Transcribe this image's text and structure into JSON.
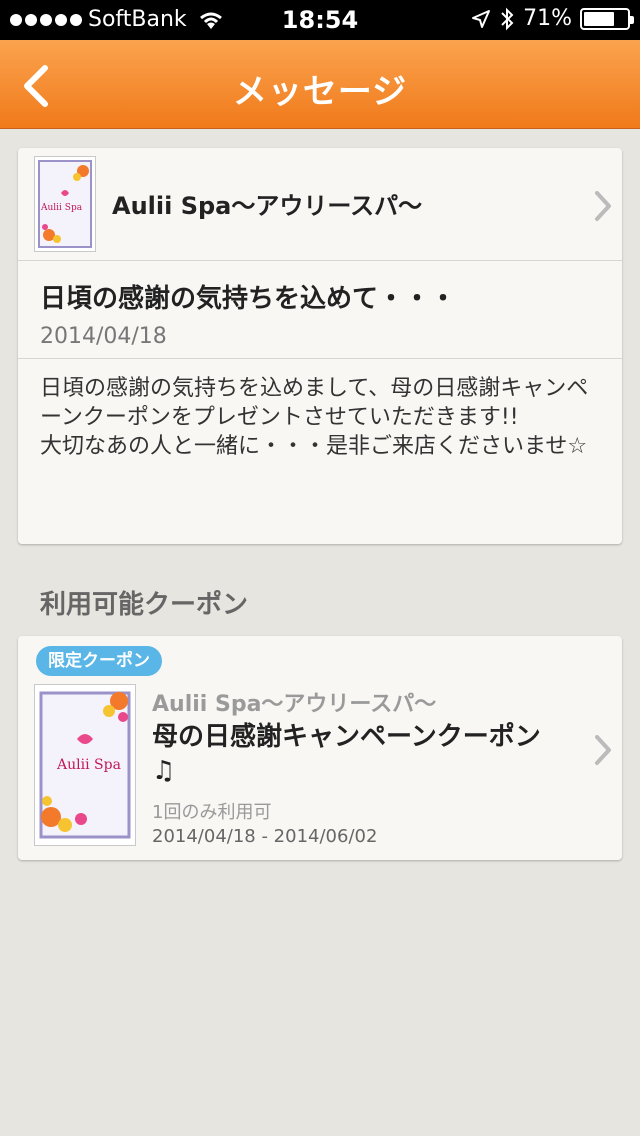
{
  "status_bar": {
    "carrier": "SoftBank",
    "time": "18:54",
    "battery_percent": "71%",
    "battery_level": 0.71
  },
  "navbar": {
    "title": "メッセージ",
    "back_icon": "chevron-left-icon"
  },
  "message": {
    "shop_name": "Aulii Spa〜アウリースパ〜",
    "thumb_brand": "Aulii Spa",
    "title": "日頃の感謝の気持ちを込めて・・・",
    "date": "2014/04/18",
    "body": "日頃の感謝の気持ちを込めまして、母の日感謝キャンペーンクーポンをプレゼントさせていただきます!!\n大切なあの人と一緒に・・・是非ご来店くださいませ☆"
  },
  "coupons_section": {
    "title": "利用可能クーポン"
  },
  "coupon": {
    "badge": "限定クーポン",
    "shop_name": "Aulii Spa〜アウリースパ〜",
    "thumb_brand": "Aulii Spa",
    "title": "母の日感謝キャンペーンクーポン♫",
    "usage": "1回のみ利用可",
    "period": "2014/04/18 - 2014/06/02"
  },
  "colors": {
    "navbar_top": "#fba34f",
    "navbar_bottom": "#f07a1a",
    "badge": "#59b6e6",
    "background": "#e7e5df"
  }
}
